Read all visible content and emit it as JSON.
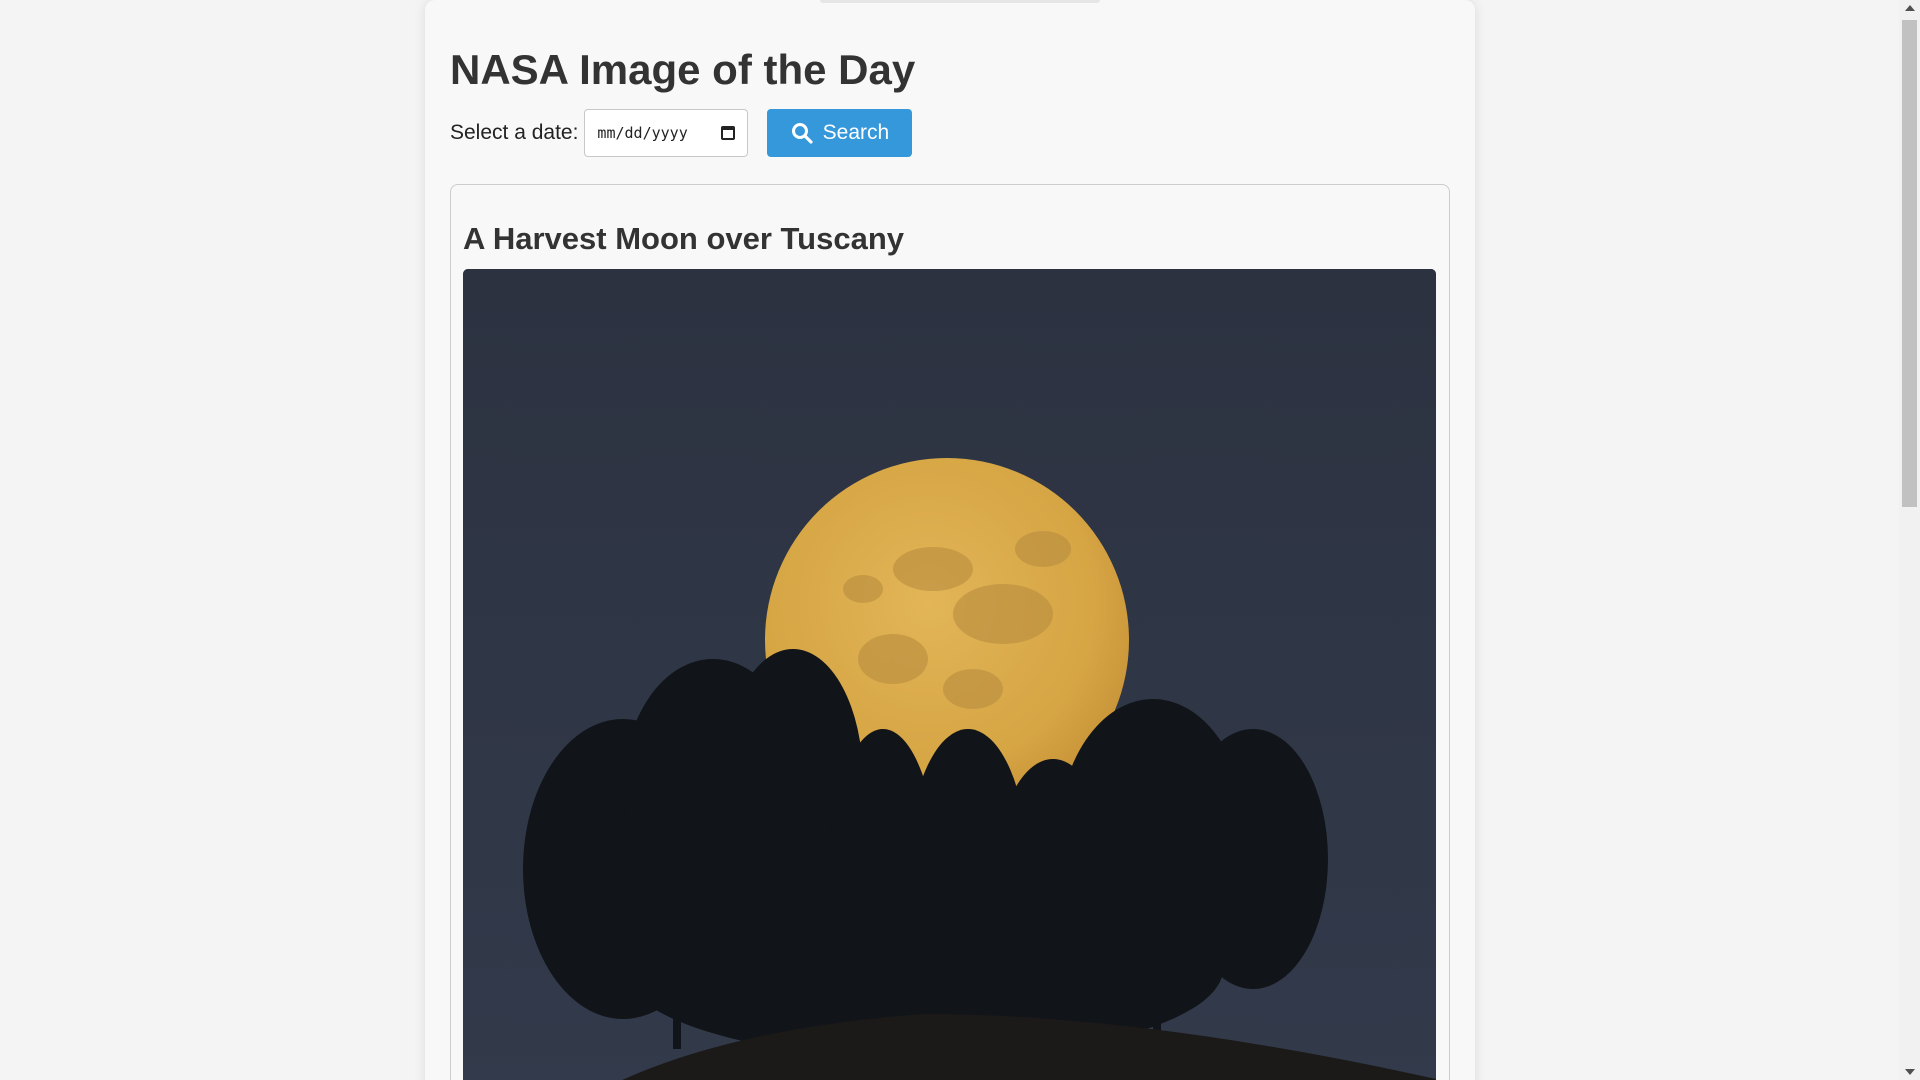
{
  "header": {
    "title": "NASA Image of the Day"
  },
  "search": {
    "date_label": "Select a date:",
    "date_placeholder": "mm/dd/yyyy",
    "button_label": "Search"
  },
  "apod": {
    "title": "A Harvest Moon over Tuscany"
  },
  "colors": {
    "accent": "#3498db",
    "background": "#f4f4f4",
    "text": "#333333"
  },
  "icons": [
    "search-icon",
    "calendar-icon"
  ]
}
